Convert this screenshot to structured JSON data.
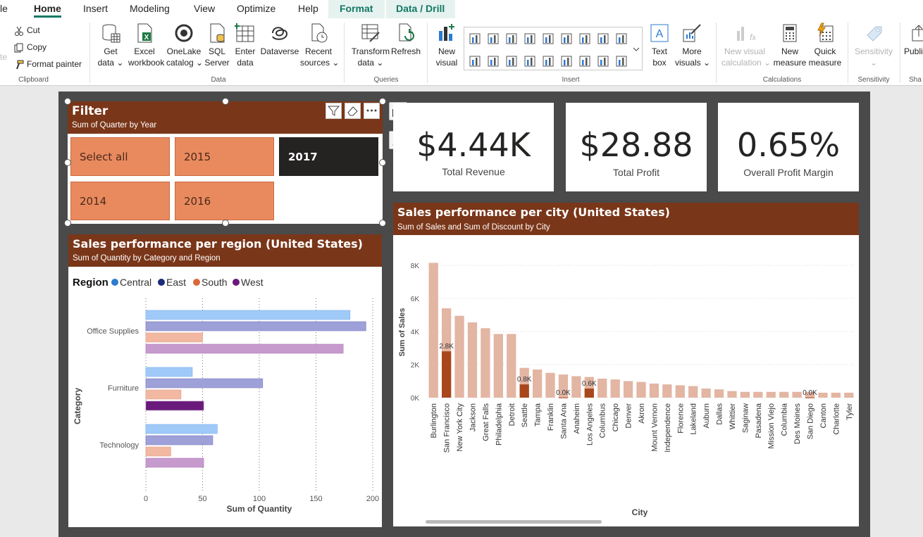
{
  "menu": {
    "items": [
      {
        "key": "file",
        "label": "le"
      },
      {
        "key": "home",
        "label": "Home"
      },
      {
        "key": "insert",
        "label": "Insert"
      },
      {
        "key": "modeling",
        "label": "Modeling"
      },
      {
        "key": "view",
        "label": "View"
      },
      {
        "key": "optimize",
        "label": "Optimize"
      },
      {
        "key": "help",
        "label": "Help"
      },
      {
        "key": "format",
        "label": "Format"
      },
      {
        "key": "data-drill",
        "label": "Data / Drill"
      }
    ]
  },
  "ribbon": {
    "clipboard": {
      "cut": "Cut",
      "copy": "Copy",
      "format_painter": "Format painter",
      "paste": "te",
      "group": "Clipboard"
    },
    "data": {
      "get_data": [
        "Get",
        "data ⌄"
      ],
      "excel": [
        "Excel",
        "workbook"
      ],
      "onelake": [
        "OneLake",
        "catalog ⌄"
      ],
      "sql": [
        "SQL",
        "Server"
      ],
      "enter": [
        "Enter",
        "data"
      ],
      "dataverse": [
        "Dataverse",
        ""
      ],
      "recent": [
        "Recent",
        "sources ⌄"
      ],
      "group": "Data"
    },
    "queries": {
      "transform": [
        "Transform",
        "data ⌄"
      ],
      "refresh": [
        "Refresh",
        ""
      ],
      "group": "Queries"
    },
    "insert": {
      "new_visual": [
        "New",
        "visual"
      ],
      "text_box": [
        "Text",
        "box"
      ],
      "more_visuals": [
        "More",
        "visuals ⌄"
      ],
      "group": "Insert"
    },
    "calculations": {
      "new_visual_calc": [
        "New visual",
        "calculation ⌄"
      ],
      "new_measure": [
        "New",
        "measure"
      ],
      "quick_measure": [
        "Quick",
        "measure"
      ],
      "group": "Calculations"
    },
    "sensitivity": {
      "label": [
        "Sensitivity",
        "⌄"
      ],
      "group": "Sensitivity"
    },
    "share": {
      "label": [
        "Publi",
        ""
      ],
      "group": "Sha"
    }
  },
  "filter_card": {
    "title": "Filter",
    "subtitle": "Sum of Quarter by Year",
    "options": [
      {
        "label": "Select all",
        "selected": false
      },
      {
        "label": "2015",
        "selected": false
      },
      {
        "label": "2017",
        "selected": true
      },
      {
        "label": "2014",
        "selected": false
      },
      {
        "label": "2016",
        "selected": false
      }
    ]
  },
  "kpis": [
    {
      "value": "$4.44K",
      "label": "Total Revenue"
    },
    {
      "value": "$28.88",
      "label": "Total Profit"
    },
    {
      "value": "0.65%",
      "label": "Overall Profit Margin"
    }
  ],
  "region_chart": {
    "title": "Sales performance per region (United States)",
    "subtitle": "Sum of Quantity by Category and Region",
    "legend_title": "Region",
    "colors": {
      "Central": "#9fcaf7",
      "East": "#9ea0d8",
      "South": "#f2b8a2",
      "West": "#c79ace",
      "West_selected": "#6a1a7a"
    },
    "legend_colors": {
      "Central": "#2b7bd1",
      "East": "#1b2a7a",
      "South": "#d9683a",
      "West": "#6a1a7a"
    }
  },
  "city_chart": {
    "title": "Sales performance per city (United States)",
    "subtitle": "Sum of Sales and Sum of Discount by City",
    "colors": {
      "bar": "#e3b5a3",
      "highlight": "#a9471c"
    }
  },
  "chart_data": [
    {
      "type": "bar",
      "orientation": "horizontal",
      "categories": [
        "Office Supplies",
        "Furniture",
        "Technology"
      ],
      "series": [
        {
          "name": "Central",
          "values": [
            180,
            41,
            63
          ]
        },
        {
          "name": "East",
          "values": [
            194,
            103,
            59
          ]
        },
        {
          "name": "South",
          "values": [
            50,
            31,
            22
          ]
        },
        {
          "name": "West",
          "values": [
            174,
            51,
            51
          ]
        }
      ],
      "xlabel": "Sum of Quantity",
      "ylabel": "Category",
      "xlim": [
        0,
        200
      ],
      "xticks": [
        0,
        50,
        100,
        150,
        200
      ],
      "grid": true,
      "legend": "top-left"
    },
    {
      "type": "bar",
      "categories": [
        "Burlington",
        "San Francisco",
        "New York City",
        "Jackson",
        "Great Falls",
        "Philadelphia",
        "Detroit",
        "Seattle",
        "Tampa",
        "Franklin",
        "Santa Ana",
        "Anaheim",
        "Los Angeles",
        "Columbus",
        "Chicago",
        "Denver",
        "Akron",
        "Mount Vernon",
        "Independence",
        "Florence",
        "Lakeland",
        "Auburn",
        "Dallas",
        "Whittier",
        "Saginaw",
        "Pasadena",
        "Mission Viejo",
        "Columbia",
        "Des Moines",
        "San Diego",
        "Canton",
        "Charlotte",
        "Tyler"
      ],
      "series": [
        {
          "name": "Sum of Sales",
          "values": [
            8150,
            5400,
            4950,
            4550,
            4200,
            3850,
            3850,
            1800,
            1700,
            1500,
            1400,
            1300,
            1250,
            1150,
            1100,
            1000,
            950,
            850,
            800,
            750,
            700,
            550,
            500,
            400,
            350,
            350,
            350,
            350,
            350,
            350,
            300,
            300,
            300
          ]
        },
        {
          "name": "Highlighted",
          "values": [
            0,
            2800,
            0,
            0,
            0,
            0,
            0,
            800,
            0,
            0,
            10,
            0,
            550,
            0,
            0,
            0,
            0,
            0,
            0,
            0,
            0,
            0,
            0,
            0,
            0,
            0,
            0,
            0,
            0,
            10,
            0,
            0,
            0
          ]
        }
      ],
      "data_labels": [
        {
          "category": "San Francisco",
          "text": "2.8K"
        },
        {
          "category": "Seattle",
          "text": "0.8K"
        },
        {
          "category": "Santa Ana",
          "text": "0.0K"
        },
        {
          "category": "Los Angeles",
          "text": "0.6K"
        },
        {
          "category": "San Diego",
          "text": "0.0K"
        }
      ],
      "xlabel": "City",
      "ylabel": "Sum of Sales",
      "ylim": [
        0,
        8000
      ],
      "yticks": [
        "0K",
        "2K",
        "4K",
        "6K",
        "8K"
      ],
      "grid": true
    }
  ]
}
